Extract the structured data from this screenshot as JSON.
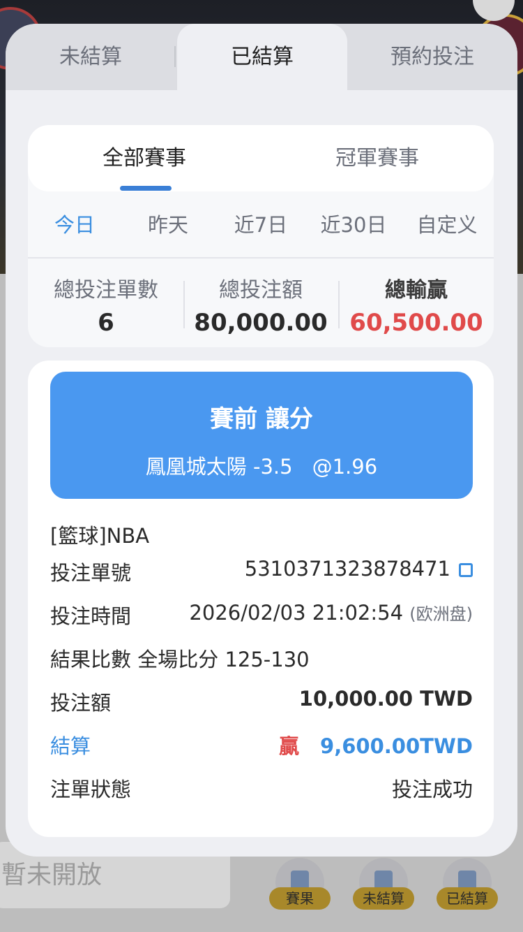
{
  "background": {
    "unavailable_text": "暫未開放",
    "nav": [
      "賽果",
      "未結算",
      "已結算"
    ]
  },
  "tabs": {
    "items": [
      "未結算",
      "已結算",
      "預約投注"
    ],
    "active_index": 1
  },
  "subtabs": {
    "items": [
      "全部賽事",
      "冠軍賽事"
    ],
    "active_index": 0
  },
  "date_filter": {
    "options": [
      "今日",
      "昨天",
      "近7日",
      "近30日",
      "自定义"
    ],
    "active_index": 0
  },
  "stats": {
    "total_bets_label": "總投注單數",
    "total_bets_value": "6",
    "total_amount_label": "總投注額",
    "total_amount_value": "80,000.00",
    "total_winloss_label": "總輸贏",
    "total_winloss_value": "60,500.00"
  },
  "bet": {
    "market": "賽前 讓分",
    "selection": "鳳凰城太陽 -3.5",
    "odds": "@1.96",
    "sport_league": "[籃球]NBA",
    "ticket_label": "投注單號",
    "ticket_no": "5310371323878471",
    "time_label": "投注時間",
    "time_value": "2026/02/03 21:02:54",
    "odds_format": "(欧洲盘)",
    "result_label": "結果比數",
    "result_value": "全場比分 125-130",
    "stake_label": "投注額",
    "stake_value": "10,000.00 TWD",
    "settle_label": "結算",
    "settle_outcome": "贏",
    "settle_value": "9,600.00TWD",
    "status_label": "注單狀態",
    "status_value": "投注成功"
  },
  "colors": {
    "accent_blue": "#4a98f0",
    "win_red": "#e04a4a",
    "link_blue": "#3a8ee0"
  }
}
